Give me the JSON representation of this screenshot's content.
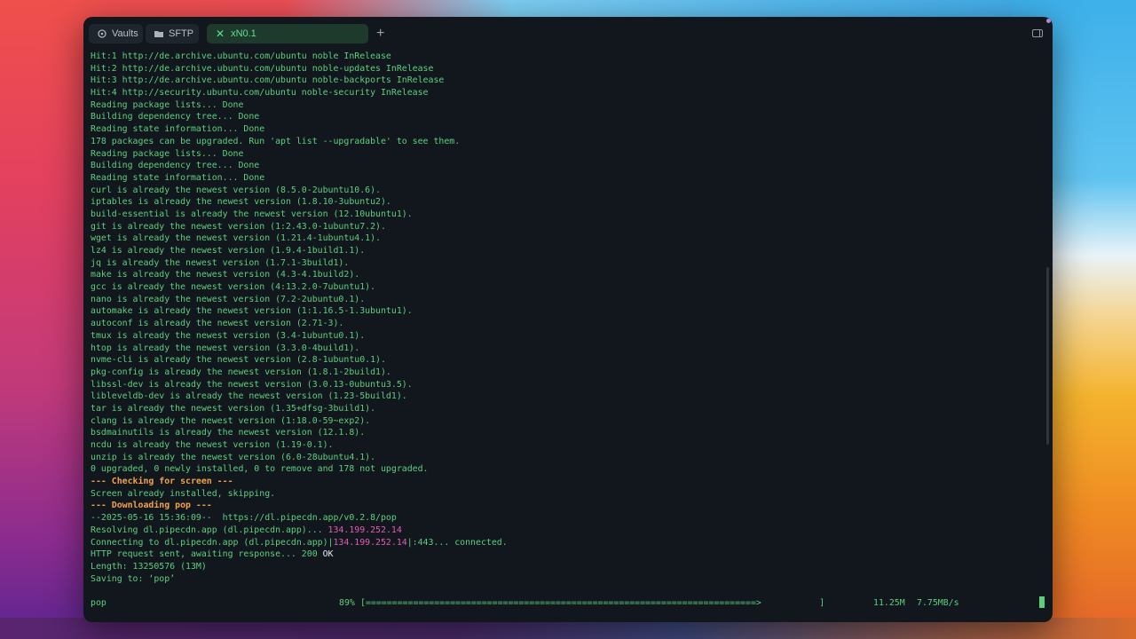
{
  "tabs": {
    "vaults": "Vaults",
    "sftp": "SFTP",
    "active": "xN0.1",
    "new_tab": "+"
  },
  "terminal_lines": [
    {
      "t": "Hit:1 http://de.archive.ubuntu.com/ubuntu noble InRelease"
    },
    {
      "t": "Hit:2 http://de.archive.ubuntu.com/ubuntu noble-updates InRelease"
    },
    {
      "t": "Hit:3 http://de.archive.ubuntu.com/ubuntu noble-backports InRelease"
    },
    {
      "t": "Hit:4 http://security.ubuntu.com/ubuntu noble-security InRelease"
    },
    {
      "t": "Reading package lists... Done"
    },
    {
      "t": "Building dependency tree... Done"
    },
    {
      "t": "Reading state information... Done"
    },
    {
      "t": "178 packages can be upgraded. Run 'apt list --upgradable' to see them."
    },
    {
      "t": "Reading package lists... Done"
    },
    {
      "t": "Building dependency tree... Done"
    },
    {
      "t": "Reading state information... Done"
    },
    {
      "t": "curl is already the newest version (8.5.0-2ubuntu10.6)."
    },
    {
      "t": "iptables is already the newest version (1.8.10-3ubuntu2)."
    },
    {
      "t": "build-essential is already the newest version (12.10ubuntu1)."
    },
    {
      "t": "git is already the newest version (1:2.43.0-1ubuntu7.2)."
    },
    {
      "t": "wget is already the newest version (1.21.4-1ubuntu4.1)."
    },
    {
      "t": "lz4 is already the newest version (1.9.4-1build1.1)."
    },
    {
      "t": "jq is already the newest version (1.7.1-3build1)."
    },
    {
      "t": "make is already the newest version (4.3-4.1build2)."
    },
    {
      "t": "gcc is already the newest version (4:13.2.0-7ubuntu1)."
    },
    {
      "t": "nano is already the newest version (7.2-2ubuntu0.1)."
    },
    {
      "t": "automake is already the newest version (1:1.16.5-1.3ubuntu1)."
    },
    {
      "t": "autoconf is already the newest version (2.71-3)."
    },
    {
      "t": "tmux is already the newest version (3.4-1ubuntu0.1)."
    },
    {
      "t": "htop is already the newest version (3.3.0-4build1)."
    },
    {
      "t": "nvme-cli is already the newest version (2.8-1ubuntu0.1)."
    },
    {
      "t": "pkg-config is already the newest version (1.8.1-2build1)."
    },
    {
      "t": "libssl-dev is already the newest version (3.0.13-0ubuntu3.5)."
    },
    {
      "t": "libleveldb-dev is already the newest version (1.23-5build1)."
    },
    {
      "t": "tar is already the newest version (1.35+dfsg-3build1)."
    },
    {
      "t": "clang is already the newest version (1:18.0-59~exp2)."
    },
    {
      "t": "bsdmainutils is already the newest version (12.1.8)."
    },
    {
      "t": "ncdu is already the newest version (1.19-0.1)."
    },
    {
      "t": "unzip is already the newest version (6.0-28ubuntu4.1)."
    },
    {
      "t": "0 upgraded, 0 newly installed, 0 to remove and 178 not upgraded."
    },
    {
      "t": "--- Checking for screen ---",
      "style": "orange"
    },
    {
      "t": "Screen already installed, skipping."
    },
    {
      "t": "--- Downloading pop ---",
      "style": "orange"
    },
    {
      "t": "--2025-05-16 15:36:09--  https://dl.pipecdn.app/v0.2.8/pop"
    },
    {
      "t": "Resolving dl.pipecdn.app (dl.pipecdn.app)... ",
      "ip": "134.199.252.14"
    },
    {
      "t": "Connecting to dl.pipecdn.app (dl.pipecdn.app)|",
      "ip": "134.199.252.14",
      "tail": "|:443... connected."
    },
    {
      "t": "HTTP request sent, awaiting response... 200 ",
      "ok": "OK"
    },
    {
      "t": "Length: 13250576 (13M)"
    },
    {
      "t": "Saving to: ‘pop’"
    }
  ],
  "status": {
    "filename": "pop",
    "percent_text": "89%",
    "progress": 0.89,
    "bar": "[==========================================================================>           ]",
    "downloaded": "11.25M",
    "speed": "7.75MB/s"
  },
  "colors": {
    "terminal_bg": "#12171d",
    "text_green": "#5ccf7f",
    "heading_orange": "#f2a24a",
    "ip_pink": "#e35cb8"
  },
  "icons": [
    "vault-icon",
    "folder-icon",
    "close-icon",
    "plus-icon",
    "split-layout-icon"
  ]
}
